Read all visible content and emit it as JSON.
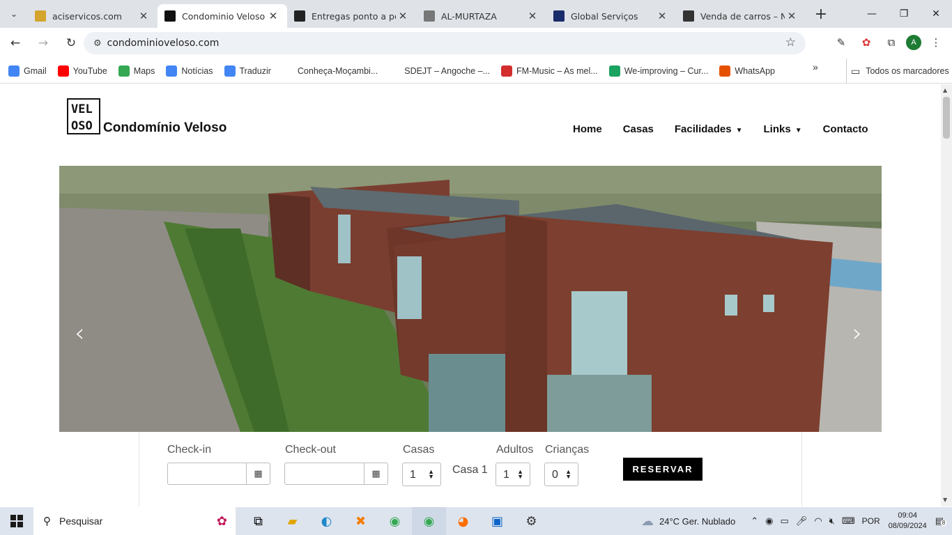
{
  "browser": {
    "tabs": [
      {
        "title": "aciservicos.com",
        "favicon": "yellow-square",
        "color": "#d4a42c",
        "active": false
      },
      {
        "title": "Condominio Veloso –",
        "favicon": "veloso-logo",
        "color": "#111111",
        "active": true
      },
      {
        "title": "Entregas ponto a por",
        "favicon": "p-icon",
        "color": "#222222",
        "active": false
      },
      {
        "title": "AL-MURTAZA",
        "favicon": "almurtaza-icon",
        "color": "#777777",
        "active": false
      },
      {
        "title": "Global Serviços",
        "favicon": "global-icon",
        "color": "#1a2b6b",
        "active": false
      },
      {
        "title": "Venda de carros – No",
        "favicon": "drop-icon",
        "color": "#333333",
        "active": false
      }
    ],
    "url": "condominioveloso.com"
  },
  "bookmarks": [
    {
      "label": "Gmail",
      "color": "#4285f4"
    },
    {
      "label": "YouTube",
      "color": "#ff0000"
    },
    {
      "label": "Maps",
      "color": "#34a853"
    },
    {
      "label": "Notícias",
      "color": "#4285f4"
    },
    {
      "label": "Traduzir",
      "color": "#4285f4"
    },
    {
      "label": "Conheça-Moçambi...",
      "color": ""
    },
    {
      "label": "SDEJT – Angoche –...",
      "color": ""
    },
    {
      "label": "FM-Music – As mel...",
      "color": "#d32f2f"
    },
    {
      "label": "We-improving – Cur...",
      "color": "#1aa260"
    },
    {
      "label": "WhatsApp",
      "color": "#e65100"
    }
  ],
  "bookmarks_all": "Todos os marcadores",
  "site": {
    "logo_line1": "VEL",
    "logo_line2": "OSO",
    "name": "Condomínio Veloso",
    "nav": [
      {
        "label": "Home",
        "dropdown": false
      },
      {
        "label": "Casas",
        "dropdown": false
      },
      {
        "label": "Facilidades",
        "dropdown": true
      },
      {
        "label": "Links",
        "dropdown": true
      },
      {
        "label": "Contacto",
        "dropdown": false
      }
    ]
  },
  "booking": {
    "checkin_label": "Check-in",
    "checkout_label": "Check-out",
    "casas_label": "Casas",
    "casas_value": "1",
    "casa_name": "Casa 1",
    "adultos_label": "Adultos",
    "adultos_value": "1",
    "criancas_label": "Crianças",
    "criancas_value": "0",
    "reserve_label": "RESERVAR"
  },
  "taskbar": {
    "search_placeholder": "Pesquisar",
    "weather": "24°C  Ger. Nublado",
    "lang": "POR",
    "time": "09:04",
    "date": "08/09/2024",
    "notifications": "8"
  }
}
